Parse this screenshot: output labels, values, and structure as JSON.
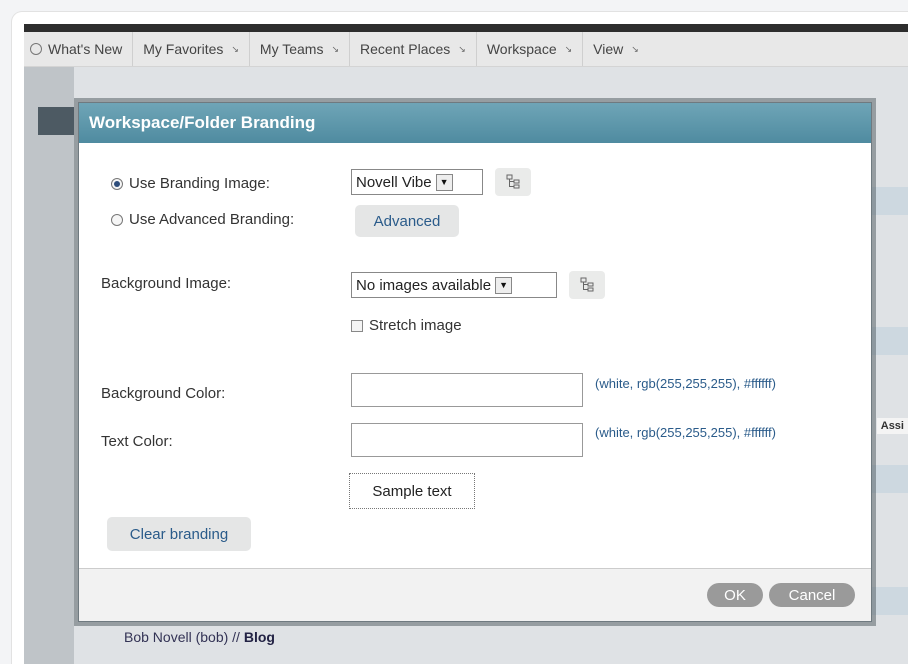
{
  "nav": {
    "items": [
      {
        "label": "What's New",
        "has_arrow": false
      },
      {
        "label": "My Favorites",
        "has_arrow": true
      },
      {
        "label": "My Teams",
        "has_arrow": true
      },
      {
        "label": "Recent Places",
        "has_arrow": true
      },
      {
        "label": "Workspace",
        "has_arrow": true
      },
      {
        "label": "View",
        "has_arrow": true
      }
    ],
    "arrow_glyph": "↘"
  },
  "background_page": {
    "assigned_header_fragment": "Assi",
    "breadcrumb_user": "Bob Novell (bob) //",
    "breadcrumb_page": "Blog"
  },
  "dialog": {
    "title": "Workspace/Folder Branding",
    "use_branding_image_label": "Use Branding Image:",
    "use_branding_image_selected": true,
    "branding_image_value": "Novell Vibe",
    "use_advanced_branding_label": "Use Advanced Branding:",
    "use_advanced_branding_selected": false,
    "advanced_button_label": "Advanced",
    "background_image_label": "Background Image:",
    "background_image_value": "No images available",
    "stretch_image_label": "Stretch image",
    "stretch_image_checked": false,
    "background_color_label": "Background Color:",
    "background_color_value": "",
    "background_color_hint": "(white, rgb(255,255,255), #ffffff)",
    "text_color_label": "Text Color:",
    "text_color_value": "",
    "text_color_hint": "(white, rgb(255,255,255), #ffffff)",
    "sample_text": "Sample text",
    "clear_branding_label": "Clear branding",
    "ok_label": "OK",
    "cancel_label": "Cancel"
  },
  "colors": {
    "title_bar": "#5a95aa",
    "link": "#2a5b8a",
    "footer_button": "#9a9a9a"
  }
}
